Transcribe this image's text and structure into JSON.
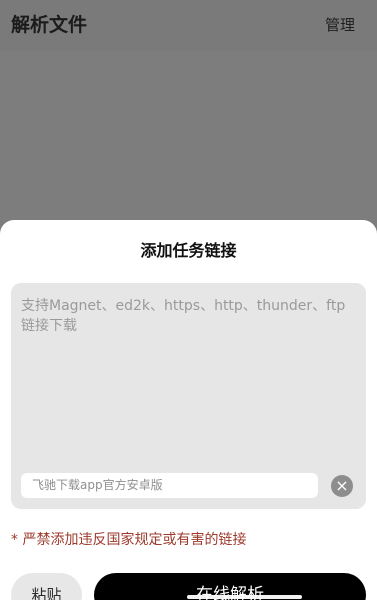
{
  "header": {
    "title": "解析文件",
    "action_label": "管理"
  },
  "sheet": {
    "title": "添加任务链接",
    "textarea_placeholder": "支持Magnet、ed2k、https、http、thunder、ftp链接下载",
    "suggestion_text": "飞驰下载app官方安卓版",
    "clear_icon": "×",
    "warning": "* 严禁添加违反国家规定或有害的链接",
    "paste_label": "粘贴",
    "parse_label": "在线解析"
  },
  "colors": {
    "overlay": "#7d7d7d",
    "sheet_background": "#ffffff",
    "warning": "#9d3a2d",
    "primary_button": "#000000"
  },
  "icons": {
    "clear": "clear-icon"
  }
}
